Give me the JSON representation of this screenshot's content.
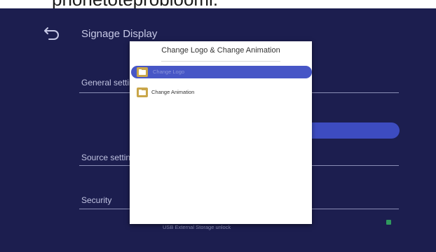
{
  "caption": {
    "text": "phonetoteproblooml."
  },
  "settings": {
    "title": "Signage Display",
    "sections": [
      {
        "label": "General settings"
      },
      {
        "label": "Source settings"
      },
      {
        "label": "Security"
      }
    ],
    "bottom_option": {
      "label": "USB External Storage unlock",
      "checked": true
    }
  },
  "dialog": {
    "title": "Change Logo & Change Animation",
    "items": [
      {
        "label": "Change Logo",
        "selected": true
      },
      {
        "label": "Change Animation",
        "selected": false
      }
    ]
  },
  "colors": {
    "background": "#1c1e4f",
    "highlight": "#4756c6",
    "folder": "#c9a64a",
    "checkbox": "#2f9a5e"
  }
}
